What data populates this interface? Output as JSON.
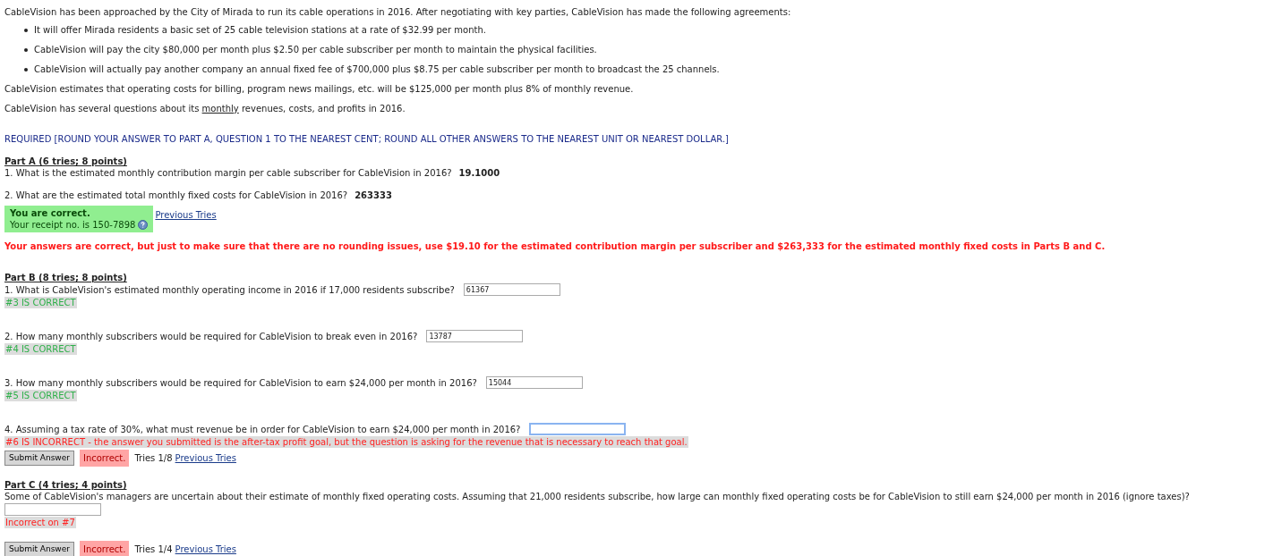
{
  "intro": "CableVision has been approached by the City of Mirada to run its cable operations in 2016. After negotiating with key parties, CableVision has made the following agreements:",
  "bullets": [
    "It will offer Mirada residents a basic set of 25 cable television stations at a rate of $32.99 per month.",
    "CableVision will pay the city $80,000 per month plus $2.50 per cable subscriber per month to maintain the physical facilities.",
    "CableVision will actually pay another company an annual fixed fee of $700,000 plus $8.75 per cable subscriber per month to broadcast the 25 channels."
  ],
  "estimate": "CableVision estimates that operating costs for billing, program news mailings, etc. will be $125,000 per month plus 8% of monthly revenue.",
  "questions_note": {
    "before": "CableVision has several questions about its ",
    "underlined": "monthly",
    "after": " revenues, costs, and profits in 2016."
  },
  "required": "REQUIRED [ROUND YOUR ANSWER TO PART A, QUESTION 1 TO THE NEAREST CENT; ROUND ALL OTHER ANSWERS TO THE NEAREST UNIT OR NEAREST DOLLAR.]",
  "part_a": {
    "heading": "Part A (6 tries; 8 points)",
    "questions": [
      {
        "text": "1. What is the estimated monthly contribution margin per cable subscriber for CableVision in 2016?",
        "answer": "19.1000"
      },
      {
        "text": "2. What are the estimated total monthly fixed costs for CableVision in 2016?",
        "answer": "263333"
      }
    ],
    "status": {
      "title": "You are correct.",
      "receipt": "Your receipt no. is 150-7898",
      "correct": true
    },
    "link": "Previous Tries"
  },
  "notice": "Your answers are correct, but just to make sure that there are no rounding issues, use $19.10 for the estimated contribution margin per subscriber and $263,333 for the estimated monthly fixed costs in Parts B and C.",
  "part_b": {
    "heading": "Part B (8 tries; 8 points)",
    "questions": [
      {
        "text": "1. What is CableVision's estimated monthly operating income in 2016 if 17,000 residents subscribe?",
        "value": "61367",
        "focused": false,
        "feedback": "#3 IS CORRECT",
        "correct": true
      },
      {
        "text": "2. How many monthly subscribers would be required for CableVision to break even in 2016?",
        "value": "13787",
        "focused": false,
        "feedback": "#4 IS CORRECT",
        "correct": true
      },
      {
        "text": "3. How many monthly subscribers would be required for CableVision to earn $24,000 per month in 2016?",
        "value": "15044",
        "focused": false,
        "feedback": "#5 IS CORRECT",
        "correct": true
      },
      {
        "text": "4. Assuming a tax rate of 30%, what must revenue be in order for CableVision to earn $24,000 per month in 2016?",
        "focused": true,
        "feedback": "#6 IS INCORRECT - the answer you submitted is the after-tax profit goal, but the question is asking for the revenue that is necessary to reach that goal.",
        "correct": false
      }
    ],
    "submit": {
      "button": "Submit Answer",
      "result": "Incorrect.",
      "correct": false,
      "tries": "Tries 1/8",
      "link": "Previous Tries"
    }
  },
  "part_c": {
    "heading": "Part C (4 tries; 4 points)",
    "question": "Some of CableVision's managers are uncertain about their estimate of monthly fixed operating costs. Assuming that 21,000 residents subscribe, how large can monthly fixed operating costs be for CableVision to still earn $24,000 per month in 2016 (ignore taxes)?",
    "feedback": "Incorrect on #7",
    "correct": false,
    "submit": {
      "button": "Submit Answer",
      "result": "Incorrect.",
      "correct": false,
      "tries": "Tries 1/4",
      "link": "Previous Tries"
    }
  }
}
